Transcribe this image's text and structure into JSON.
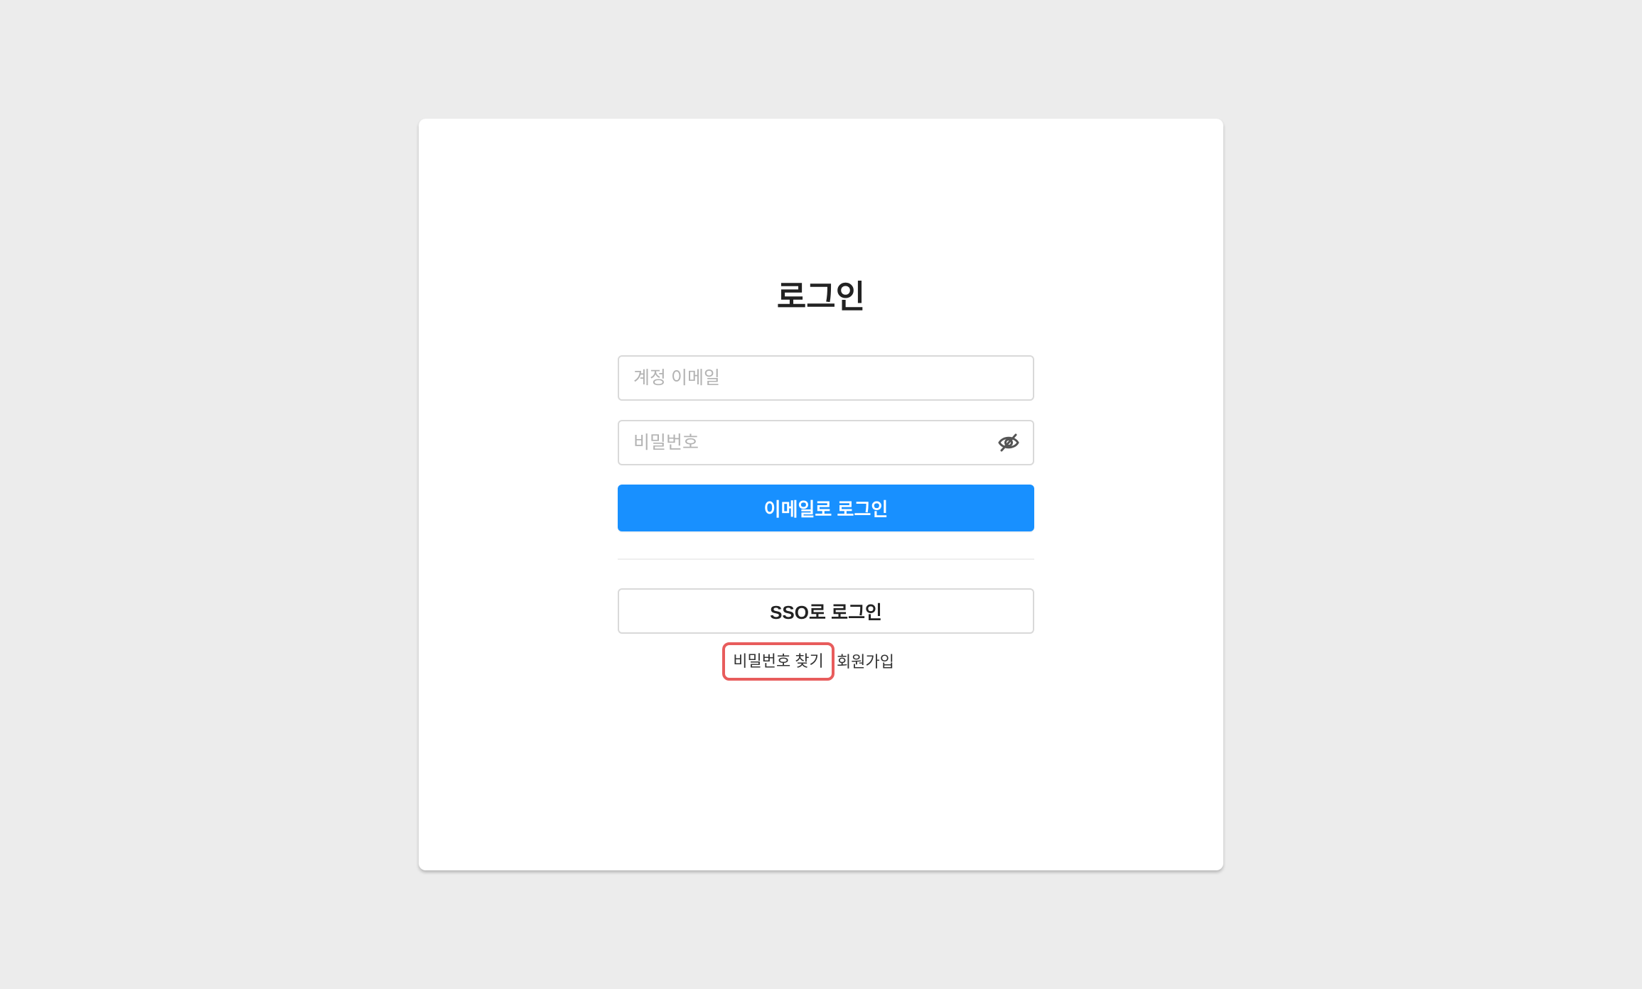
{
  "login": {
    "title": "로그인",
    "email_placeholder": "계정 이메일",
    "password_placeholder": "비밀번호",
    "email_login_label": "이메일로 로그인",
    "sso_login_label": "SSO로 로그인",
    "find_password_label": "비밀번호 찾기",
    "signup_label": "회원가입"
  },
  "icons": {
    "password_toggle": "eye-off-icon"
  },
  "colors": {
    "background": "#ececec",
    "card": "#ffffff",
    "primary": "#1890ff",
    "highlight": "#e85c5c"
  }
}
